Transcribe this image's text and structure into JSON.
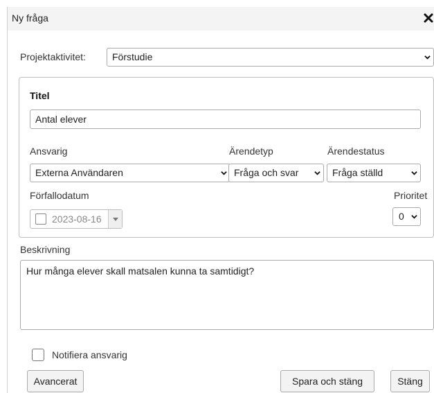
{
  "dialog": {
    "title": "Ny fråga",
    "close_symbol": "✕"
  },
  "project_activity": {
    "label": "Projektaktivitet:",
    "value": "Förstudie"
  },
  "titel": {
    "label": "Titel",
    "value": "Antal elever"
  },
  "ansvarig": {
    "label": "Ansvarig",
    "value": "Externa Användaren"
  },
  "arendetyp": {
    "label": "Ärendetyp",
    "value": "Fråga och svar"
  },
  "arendestatus": {
    "label": "Ärendestatus",
    "value": "Fråga ställd"
  },
  "forfallodatum": {
    "label": "Förfallodatum",
    "value": "2023-08-16",
    "enabled": false
  },
  "prioritet": {
    "label": "Prioritet",
    "value": "0"
  },
  "beskrivning": {
    "label": "Beskrivning",
    "value": "Hur många elever skall matsalen kunna ta samtidigt?"
  },
  "notify": {
    "label": "Notifiera ansvarig",
    "checked": false
  },
  "buttons": {
    "advanced": "Avancerat",
    "save_close": "Spara och stäng",
    "close": "Stäng"
  }
}
